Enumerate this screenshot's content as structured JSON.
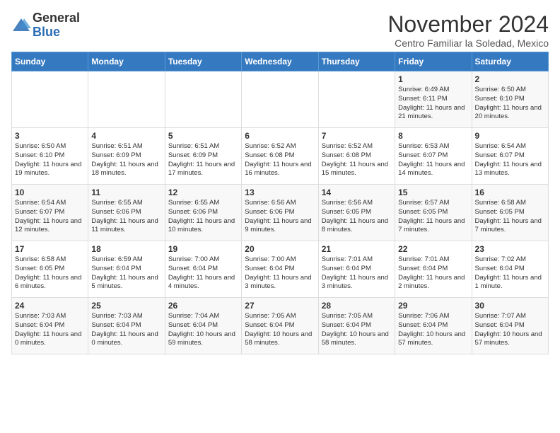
{
  "header": {
    "logo_line1": "General",
    "logo_line2": "Blue",
    "month": "November 2024",
    "location": "Centro Familiar la Soledad, Mexico"
  },
  "weekdays": [
    "Sunday",
    "Monday",
    "Tuesday",
    "Wednesday",
    "Thursday",
    "Friday",
    "Saturday"
  ],
  "weeks": [
    [
      {
        "day": "",
        "text": ""
      },
      {
        "day": "",
        "text": ""
      },
      {
        "day": "",
        "text": ""
      },
      {
        "day": "",
        "text": ""
      },
      {
        "day": "",
        "text": ""
      },
      {
        "day": "1",
        "text": "Sunrise: 6:49 AM\nSunset: 6:11 PM\nDaylight: 11 hours and 21 minutes."
      },
      {
        "day": "2",
        "text": "Sunrise: 6:50 AM\nSunset: 6:10 PM\nDaylight: 11 hours and 20 minutes."
      }
    ],
    [
      {
        "day": "3",
        "text": "Sunrise: 6:50 AM\nSunset: 6:10 PM\nDaylight: 11 hours and 19 minutes."
      },
      {
        "day": "4",
        "text": "Sunrise: 6:51 AM\nSunset: 6:09 PM\nDaylight: 11 hours and 18 minutes."
      },
      {
        "day": "5",
        "text": "Sunrise: 6:51 AM\nSunset: 6:09 PM\nDaylight: 11 hours and 17 minutes."
      },
      {
        "day": "6",
        "text": "Sunrise: 6:52 AM\nSunset: 6:08 PM\nDaylight: 11 hours and 16 minutes."
      },
      {
        "day": "7",
        "text": "Sunrise: 6:52 AM\nSunset: 6:08 PM\nDaylight: 11 hours and 15 minutes."
      },
      {
        "day": "8",
        "text": "Sunrise: 6:53 AM\nSunset: 6:07 PM\nDaylight: 11 hours and 14 minutes."
      },
      {
        "day": "9",
        "text": "Sunrise: 6:54 AM\nSunset: 6:07 PM\nDaylight: 11 hours and 13 minutes."
      }
    ],
    [
      {
        "day": "10",
        "text": "Sunrise: 6:54 AM\nSunset: 6:07 PM\nDaylight: 11 hours and 12 minutes."
      },
      {
        "day": "11",
        "text": "Sunrise: 6:55 AM\nSunset: 6:06 PM\nDaylight: 11 hours and 11 minutes."
      },
      {
        "day": "12",
        "text": "Sunrise: 6:55 AM\nSunset: 6:06 PM\nDaylight: 11 hours and 10 minutes."
      },
      {
        "day": "13",
        "text": "Sunrise: 6:56 AM\nSunset: 6:06 PM\nDaylight: 11 hours and 9 minutes."
      },
      {
        "day": "14",
        "text": "Sunrise: 6:56 AM\nSunset: 6:05 PM\nDaylight: 11 hours and 8 minutes."
      },
      {
        "day": "15",
        "text": "Sunrise: 6:57 AM\nSunset: 6:05 PM\nDaylight: 11 hours and 7 minutes."
      },
      {
        "day": "16",
        "text": "Sunrise: 6:58 AM\nSunset: 6:05 PM\nDaylight: 11 hours and 7 minutes."
      }
    ],
    [
      {
        "day": "17",
        "text": "Sunrise: 6:58 AM\nSunset: 6:05 PM\nDaylight: 11 hours and 6 minutes."
      },
      {
        "day": "18",
        "text": "Sunrise: 6:59 AM\nSunset: 6:04 PM\nDaylight: 11 hours and 5 minutes."
      },
      {
        "day": "19",
        "text": "Sunrise: 7:00 AM\nSunset: 6:04 PM\nDaylight: 11 hours and 4 minutes."
      },
      {
        "day": "20",
        "text": "Sunrise: 7:00 AM\nSunset: 6:04 PM\nDaylight: 11 hours and 3 minutes."
      },
      {
        "day": "21",
        "text": "Sunrise: 7:01 AM\nSunset: 6:04 PM\nDaylight: 11 hours and 3 minutes."
      },
      {
        "day": "22",
        "text": "Sunrise: 7:01 AM\nSunset: 6:04 PM\nDaylight: 11 hours and 2 minutes."
      },
      {
        "day": "23",
        "text": "Sunrise: 7:02 AM\nSunset: 6:04 PM\nDaylight: 11 hours and 1 minute."
      }
    ],
    [
      {
        "day": "24",
        "text": "Sunrise: 7:03 AM\nSunset: 6:04 PM\nDaylight: 11 hours and 0 minutes."
      },
      {
        "day": "25",
        "text": "Sunrise: 7:03 AM\nSunset: 6:04 PM\nDaylight: 11 hours and 0 minutes."
      },
      {
        "day": "26",
        "text": "Sunrise: 7:04 AM\nSunset: 6:04 PM\nDaylight: 10 hours and 59 minutes."
      },
      {
        "day": "27",
        "text": "Sunrise: 7:05 AM\nSunset: 6:04 PM\nDaylight: 10 hours and 58 minutes."
      },
      {
        "day": "28",
        "text": "Sunrise: 7:05 AM\nSunset: 6:04 PM\nDaylight: 10 hours and 58 minutes."
      },
      {
        "day": "29",
        "text": "Sunrise: 7:06 AM\nSunset: 6:04 PM\nDaylight: 10 hours and 57 minutes."
      },
      {
        "day": "30",
        "text": "Sunrise: 7:07 AM\nSunset: 6:04 PM\nDaylight: 10 hours and 57 minutes."
      }
    ]
  ]
}
